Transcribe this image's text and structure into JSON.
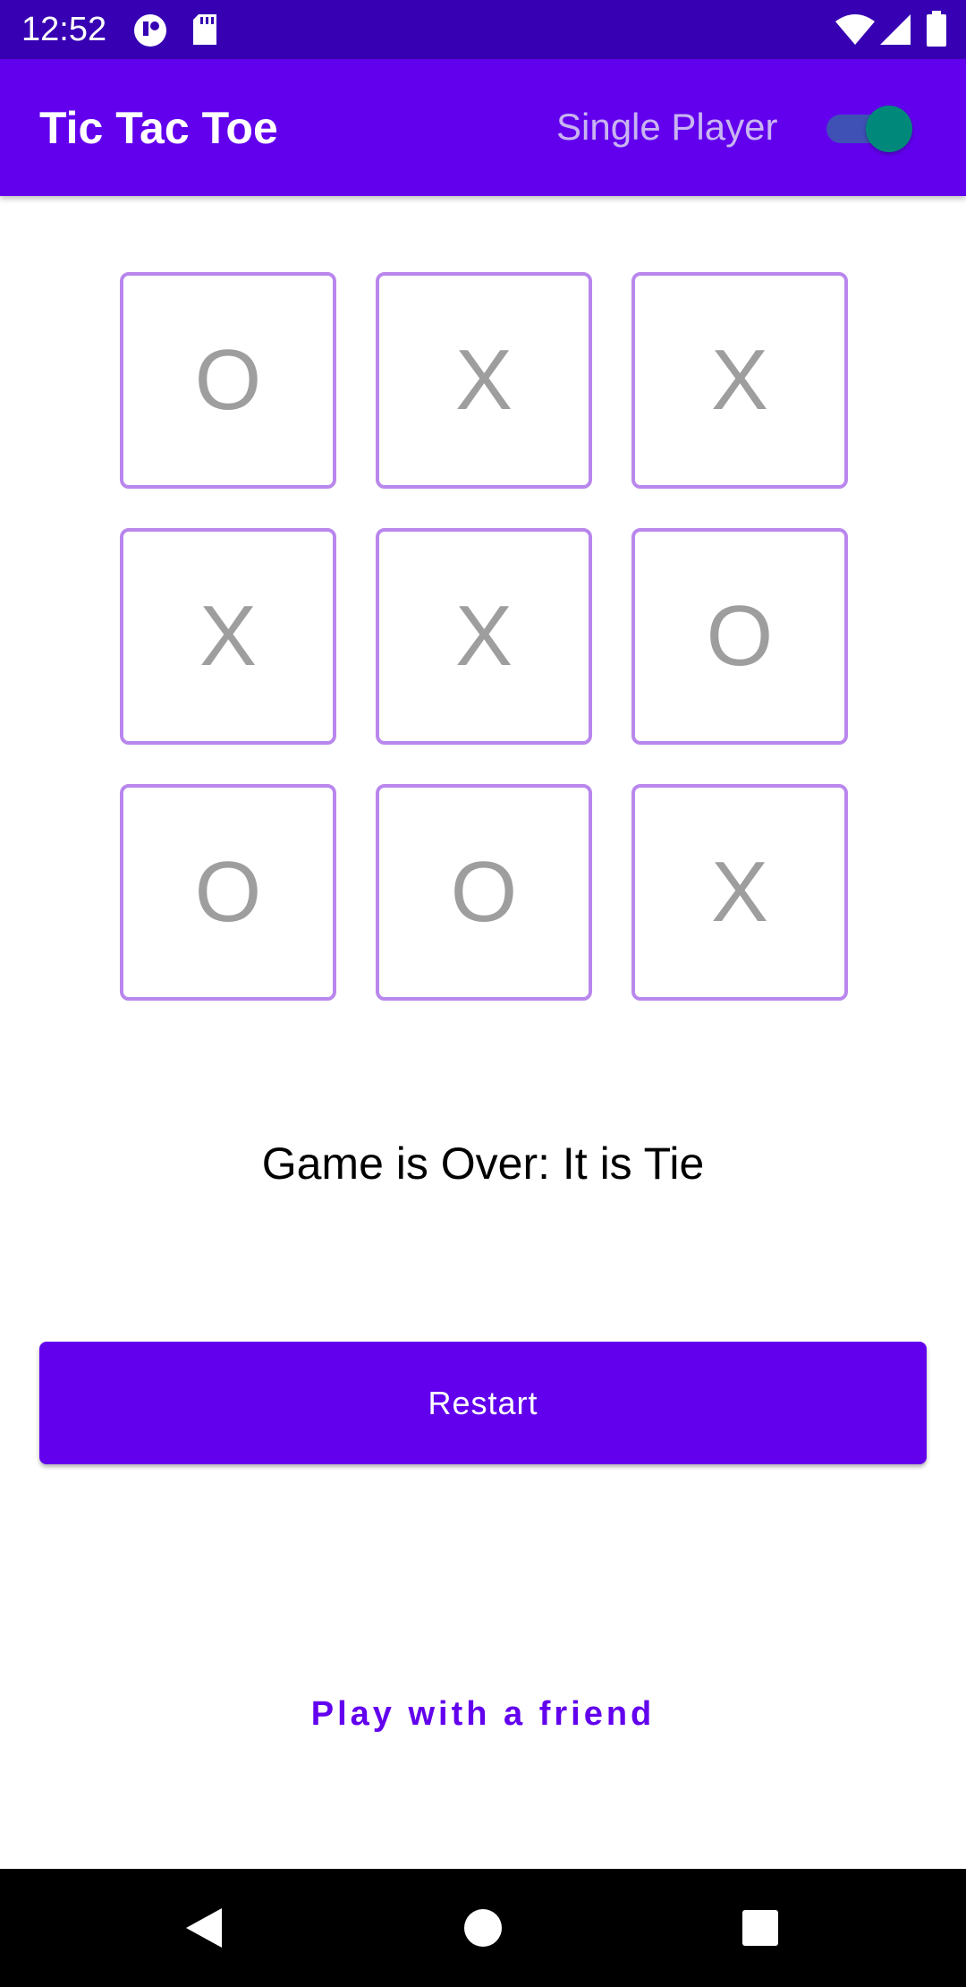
{
  "status_bar": {
    "time": "12:52",
    "background": "#3700B3",
    "icons": [
      "app-notification-icon",
      "sd-card-icon",
      "wifi-icon",
      "cellular-signal-icon",
      "battery-icon"
    ]
  },
  "app_bar": {
    "title": "Tic Tac Toe",
    "mode_label": "Single Player",
    "single_player_enabled": true,
    "background": "#6200EE"
  },
  "board": {
    "rows": [
      [
        "O",
        "X",
        "X"
      ],
      [
        "X",
        "X",
        "O"
      ],
      [
        "O",
        "O",
        "X"
      ]
    ],
    "cell_border_color": "#b987ec",
    "mark_color": "#9e9e9e"
  },
  "result_text": "Game is Over: It is Tie",
  "restart_button": {
    "label": "Restart",
    "background": "#6200EE"
  },
  "friend_button": {
    "label": "Play with a friend",
    "color": "#6200EE"
  },
  "nav_bar": {
    "buttons": [
      "back-icon",
      "home-icon",
      "recents-icon"
    ]
  }
}
